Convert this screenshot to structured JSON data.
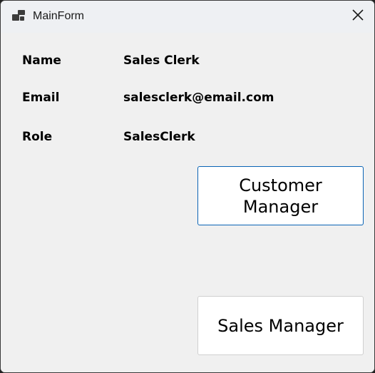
{
  "window": {
    "title": "MainForm"
  },
  "fields": [
    {
      "label": "Name",
      "value": "Sales Clerk"
    },
    {
      "label": "Email",
      "value": "salesclerk@email.com"
    },
    {
      "label": "Role",
      "value": "SalesClerk"
    }
  ],
  "buttons": {
    "customer_manager": "Customer Manager",
    "sales_manager": "Sales Manager"
  },
  "icons": {
    "app": "windows-form-icon",
    "close": "close-icon"
  },
  "colors": {
    "focus_border": "#0a64b5",
    "form_background": "#f0f0f0",
    "button_background": "#ffffff"
  }
}
